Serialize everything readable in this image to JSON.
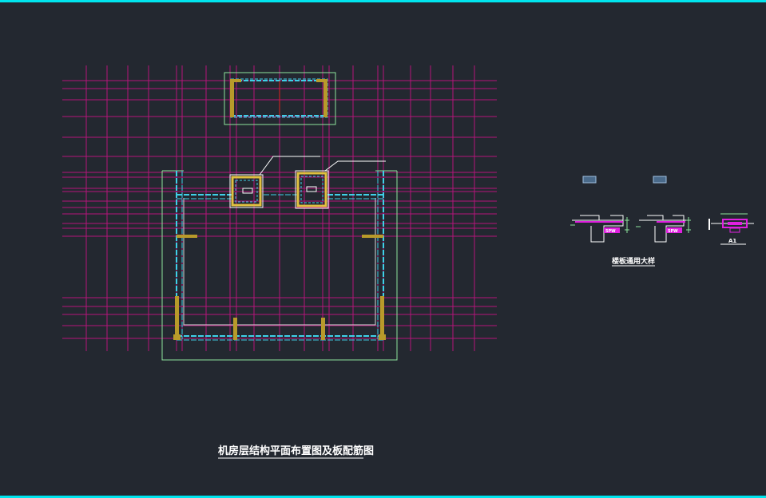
{
  "drawing": {
    "main_title": "机房层结构平面布置图及板配筋图",
    "detail_title": "楼板通用大样",
    "section_label": "A1",
    "detail_tag_1": "5PW",
    "detail_tag_2": "5PW"
  },
  "colors": {
    "background": "#232830",
    "frame": "#00e5ee",
    "grid": "#b4157a",
    "wall": "#3fd0e8",
    "column": "#b89a2a",
    "outline": "#8ee59b",
    "text": "#ffffff",
    "magenta": "#e020e0"
  }
}
